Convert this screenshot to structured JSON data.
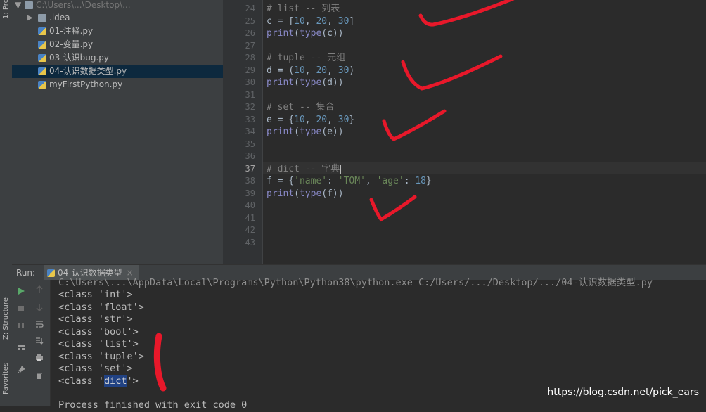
{
  "left_strip": {
    "tab_project": "1: Proj",
    "tab_structure": "Z: Structure",
    "tab_favorites": "Favorites"
  },
  "project": {
    "root_label": "C:\\Users\\...\\Desktop\\...",
    "items": [
      {
        "label": ".idea",
        "type": "folder"
      },
      {
        "label": "01-注释.py",
        "type": "python"
      },
      {
        "label": "02-变量.py",
        "type": "python"
      },
      {
        "label": "03-认识bug.py",
        "type": "python"
      },
      {
        "label": "04-认识数据类型.py",
        "type": "python",
        "selected": true
      },
      {
        "label": "myFirstPython.py",
        "type": "python"
      }
    ]
  },
  "editor": {
    "line_numbers": [
      "24",
      "25",
      "26",
      "27",
      "28",
      "29",
      "30",
      "31",
      "32",
      "33",
      "34",
      "35",
      "36",
      "37",
      "38",
      "39",
      "40",
      "41",
      "42",
      "43"
    ],
    "current_line": "37",
    "code": {
      "l24": [
        "# list -- 列表"
      ],
      "l25": [
        "c",
        " = [",
        "10",
        ", ",
        "20",
        ", ",
        "30",
        "]"
      ],
      "l26": [
        "print",
        "(",
        "type",
        "(c))"
      ],
      "l28": [
        "# tuple -- 元组"
      ],
      "l29": [
        "d",
        " = (",
        "10",
        ", ",
        "20",
        ", ",
        "30",
        ")"
      ],
      "l30": [
        "print",
        "(",
        "type",
        "(d))"
      ],
      "l32": [
        "# set -- 集合"
      ],
      "l33": [
        "e",
        " = {",
        "10",
        ", ",
        "20",
        ", ",
        "30",
        "}"
      ],
      "l34": [
        "print",
        "(",
        "type",
        "(e))"
      ],
      "l37": [
        "# dict -- 字典"
      ],
      "l38": [
        "f",
        " = {",
        "'name'",
        ": ",
        "'TOM'",
        ", ",
        "'age'",
        ": ",
        "18",
        "}"
      ],
      "l39": [
        "print",
        "(",
        "type",
        "(f))"
      ]
    }
  },
  "run": {
    "label": "Run:",
    "tab_label": "04-认识数据类型",
    "tab_close": "×",
    "command_line": "C:\\Users\\...\\AppData\\Local\\Programs\\Python\\Python38\\python.exe C:/Users/.../Desktop/.../04-认识数据类型.py",
    "output": [
      "<class 'int'>",
      "<class 'float'>",
      "<class 'str'>",
      "<class 'bool'>",
      "<class 'list'>",
      "<class 'tuple'>",
      "<class 'set'>"
    ],
    "dict_prefix": "<class '",
    "dict_word": "dict",
    "dict_suffix": "'>",
    "finish": "Process finished with exit code 0"
  },
  "watermark": "https://blog.csdn.net/pick_ears",
  "colors": {
    "annotation": "#e8182a",
    "selection": "#0d293e",
    "comment": "#808080",
    "number": "#6897bb",
    "string": "#6a8759",
    "builtin": "#8888c6"
  }
}
